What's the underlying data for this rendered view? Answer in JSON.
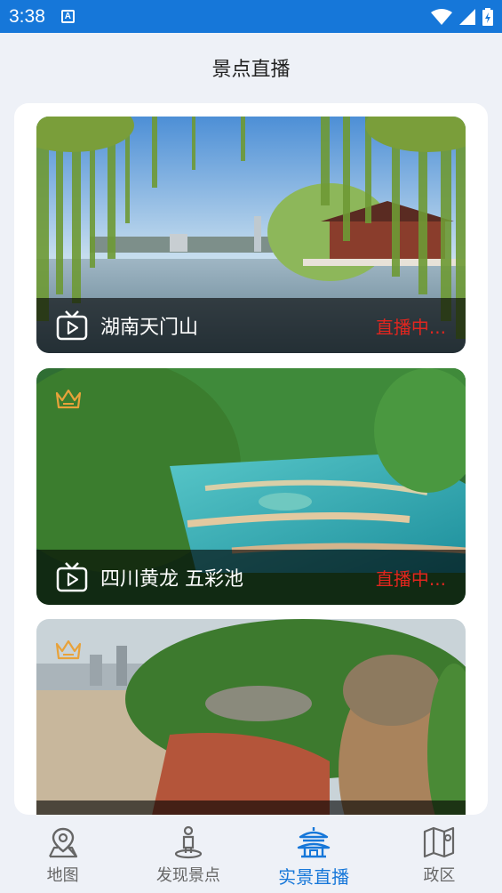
{
  "status_bar": {
    "time": "3:38",
    "notification_glyph": "A"
  },
  "header": {
    "title": "景点直播"
  },
  "spots": [
    {
      "name": "湖南天门山",
      "status": "直播中...",
      "premium": false
    },
    {
      "name": "四川黄龙 五彩池",
      "status": "直播中...",
      "premium": true
    },
    {
      "name": "",
      "status": "",
      "premium": true
    }
  ],
  "bottom_nav": {
    "items": [
      {
        "label": "地图",
        "icon": "map-pin-icon",
        "active": false
      },
      {
        "label": "发现景点",
        "icon": "explorer-icon",
        "active": false
      },
      {
        "label": "实景直播",
        "icon": "pavilion-icon",
        "active": true
      },
      {
        "label": "政区",
        "icon": "folded-map-icon",
        "active": false
      }
    ]
  },
  "colors": {
    "accent": "#1677d9",
    "live": "#e0261f",
    "background": "#eef1f7"
  }
}
